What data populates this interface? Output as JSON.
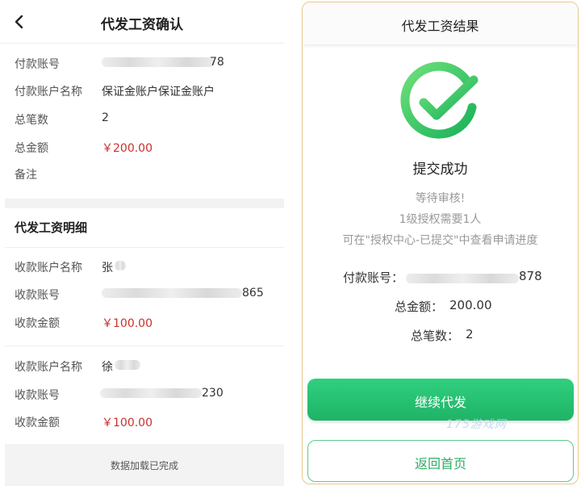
{
  "left": {
    "title": "代发工资确认",
    "fields": [
      {
        "label": "付款账号",
        "value_suffix": "78"
      },
      {
        "label": "付款账户名称",
        "value": "保证金账户保证金账户"
      },
      {
        "label": "总笔数",
        "value": "2"
      },
      {
        "label": "总金额",
        "value": "￥200.00"
      },
      {
        "label": "备注",
        "value": ""
      }
    ],
    "detail_title": "代发工资明细",
    "details": [
      {
        "name_label": "收款账户名称",
        "name_visible": "张",
        "account_label": "收款账号",
        "account_suffix": "865",
        "amount_label": "收款金额",
        "amount": "￥100.00"
      },
      {
        "name_label": "收款账户名称",
        "name_visible": "徐",
        "account_label": "收款账号",
        "account_suffix": "230",
        "amount_label": "收款金额",
        "amount": "￥100.00"
      }
    ],
    "footer": "数据加载已完成"
  },
  "right": {
    "title": "代发工资结果",
    "status": "提交成功",
    "messages": [
      "等待审核!",
      "1级授权需要1人",
      "可在\"授权中心-已提交\"中查看申请进度"
    ],
    "pay_account_label": "付款账号：",
    "pay_account_suffix": "878",
    "total_amount_label": "总金额：",
    "total_amount": "200.00",
    "total_count_label": "总笔数：",
    "total_count": "2",
    "continue_button": "继续代发",
    "home_button": "返回首页",
    "watermark": "175游戏网"
  },
  "colors": {
    "accent_green": "#1fb366",
    "amount_red": "#c9302c",
    "border_gold": "#e8c88a"
  },
  "icons": {
    "back": "chevron-left-icon",
    "success": "check-circle-icon"
  }
}
